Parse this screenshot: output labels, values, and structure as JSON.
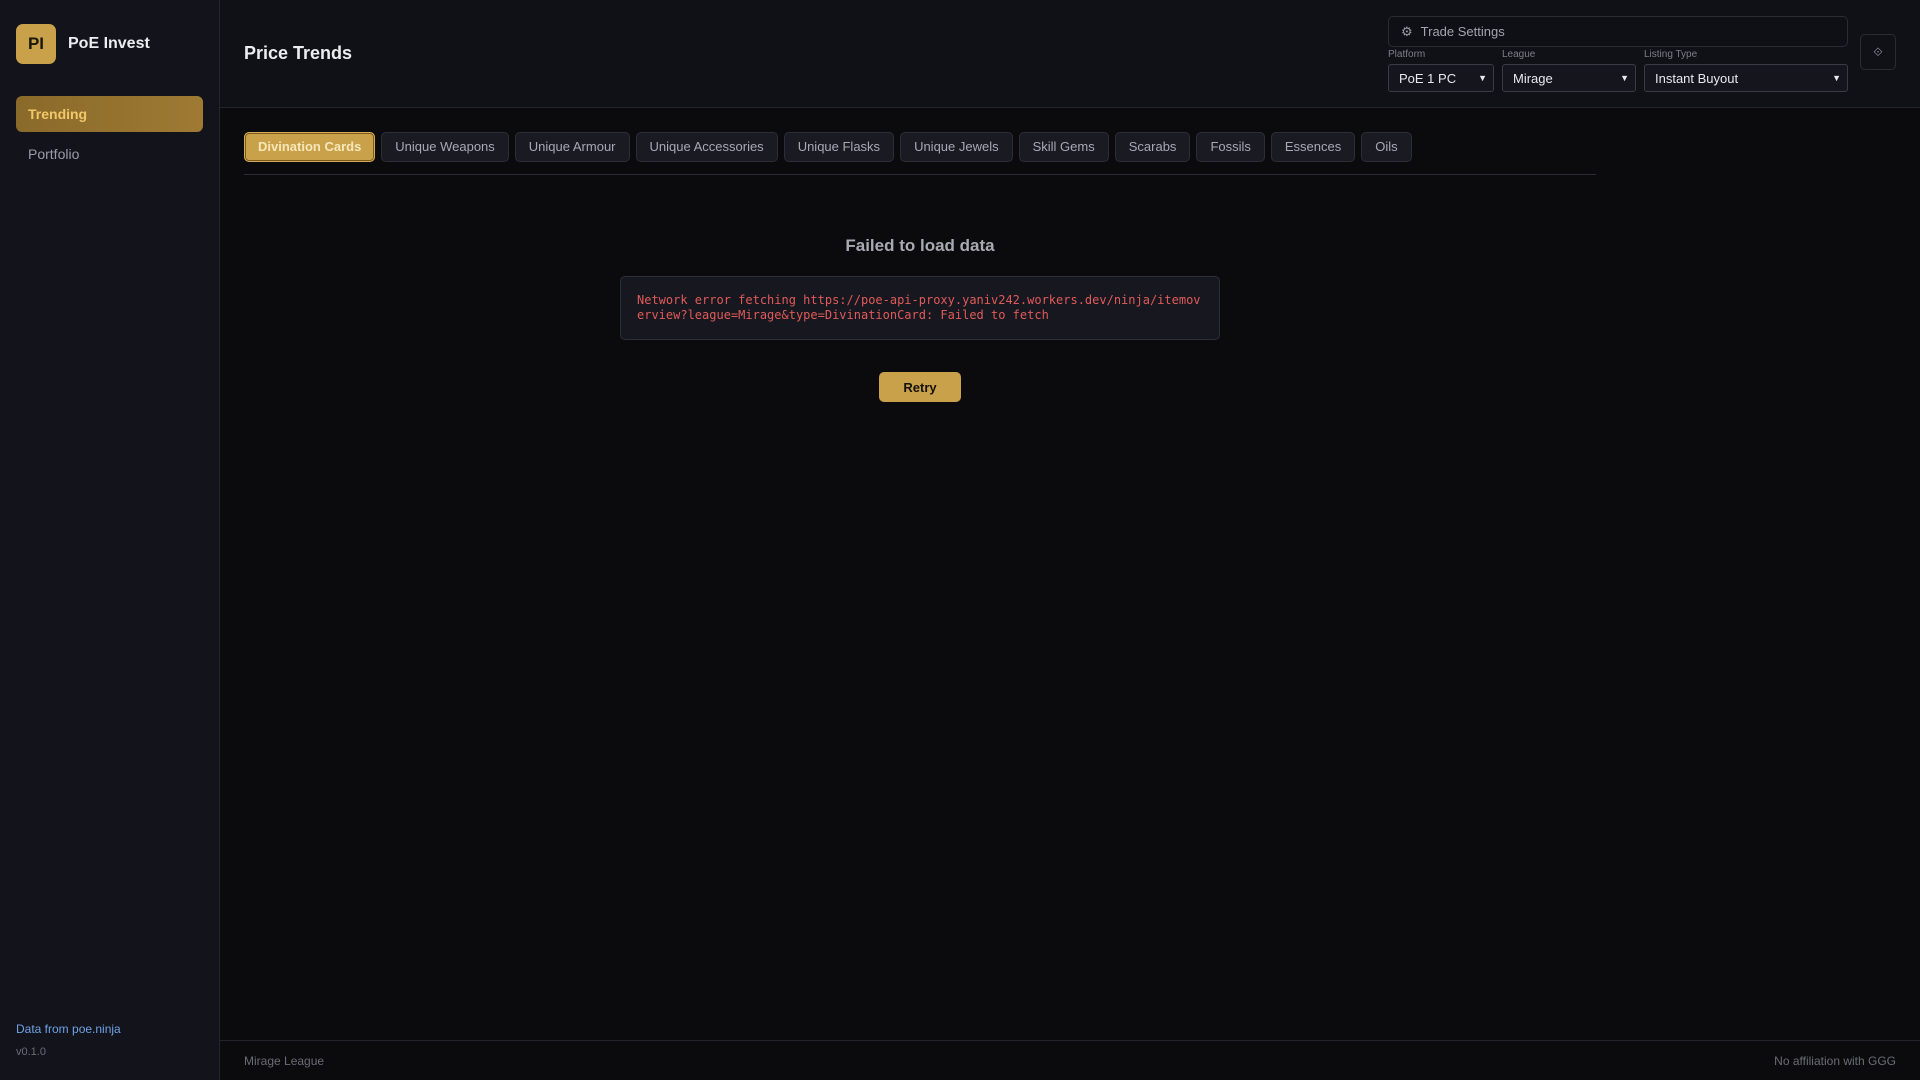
{
  "brand": {
    "logo_text": "PI",
    "name": "PoE Invest"
  },
  "sidebar": {
    "items": [
      {
        "label": "Trending",
        "active": true
      },
      {
        "label": "Portfolio",
        "active": false
      }
    ],
    "data_link": "Data from poe.ninja",
    "version": "v0.1.0"
  },
  "header": {
    "title": "Price Trends",
    "trade_settings": {
      "label": "Trade Settings",
      "gear_icon": "⚙",
      "platform": {
        "label": "Platform",
        "value": "PoE 1 PC"
      },
      "league": {
        "label": "League",
        "value": "Mirage"
      },
      "listing_type": {
        "label": "Listing Type",
        "value": "Instant Buyout"
      }
    },
    "collapse_icon": "⟐"
  },
  "tabs": [
    {
      "label": "Divination Cards",
      "active": true
    },
    {
      "label": "Unique Weapons"
    },
    {
      "label": "Unique Armour"
    },
    {
      "label": "Unique Accessories"
    },
    {
      "label": "Unique Flasks"
    },
    {
      "label": "Unique Jewels"
    },
    {
      "label": "Skill Gems"
    },
    {
      "label": "Scarabs"
    },
    {
      "label": "Fossils"
    },
    {
      "label": "Essences"
    },
    {
      "label": "Oils"
    }
  ],
  "error": {
    "title": "Failed to load data",
    "message": "Network error fetching https://poe-api-proxy.yaniv242.workers.dev/ninja/itemoverview?league=Mirage&type=DivinationCard: Failed to fetch",
    "retry_label": "Retry"
  },
  "footer": {
    "left": "Mirage League",
    "right": "No affiliation with GGG"
  },
  "colors": {
    "accent": "#c9a14a",
    "error": "#e05a5a",
    "link": "#6fa0e6"
  }
}
